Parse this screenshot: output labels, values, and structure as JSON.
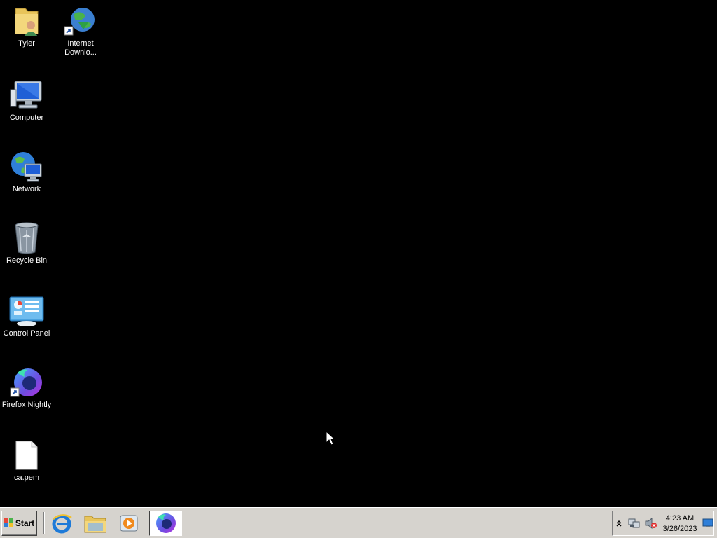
{
  "desktop": {
    "icons": [
      {
        "label": "Tyler",
        "icon": "user-folder-icon"
      },
      {
        "label": "Internet\nDownlo...",
        "icon": "internet-download-manager-icon"
      },
      {
        "label": "Computer",
        "icon": "computer-icon"
      },
      {
        "label": "Network",
        "icon": "network-icon"
      },
      {
        "label": "Recycle Bin",
        "icon": "recycle-bin-icon"
      },
      {
        "label": "Control Panel",
        "icon": "control-panel-icon"
      },
      {
        "label": "Firefox Nightly",
        "icon": "firefox-nightly-icon"
      },
      {
        "label": "ca.pem",
        "icon": "file-icon"
      }
    ],
    "background_color": "#000000"
  },
  "taskbar": {
    "start_label": "Start",
    "quick_launch": [
      "internet-explorer-icon",
      "windows-explorer-icon",
      "media-player-icon"
    ],
    "active_task": "firefox-nightly-icon",
    "tray_icons": [
      "show-hidden-icons-chevron",
      "network-icon",
      "volume-muted-icon"
    ],
    "clock_time": "4:23 AM",
    "clock_date": "3/26/2023",
    "color": "#d6d3ce"
  }
}
